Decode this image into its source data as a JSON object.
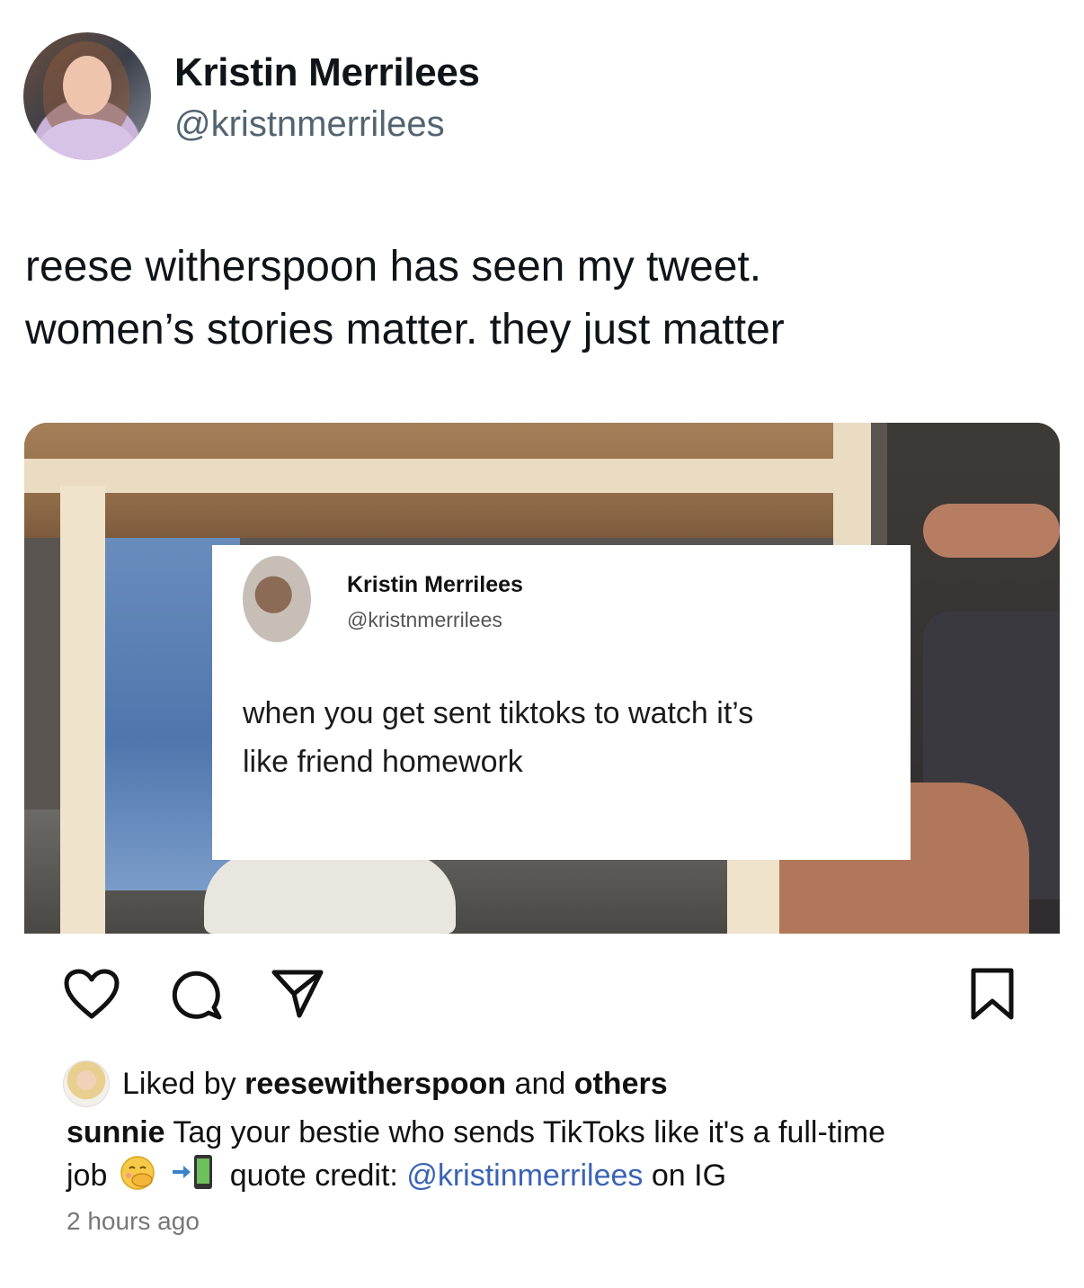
{
  "tweet": {
    "display_name": "Kristin Merrilees",
    "handle": "@kristnmerrilees",
    "text_lines": [
      "reese witherspoon has seen my tweet.",
      "women’s stories matter. they just matter"
    ]
  },
  "embedded_post": {
    "quote_card": {
      "display_name": "Kristin Merrilees",
      "handle": "@kristnmerrilees",
      "text_lines": [
        "when you get sent tiktoks to watch it’s",
        "like friend homework"
      ]
    },
    "actions": {
      "like_icon": "heart-icon",
      "comment_icon": "comment-icon",
      "share_icon": "send-icon",
      "save_icon": "bookmark-icon"
    },
    "likes": {
      "prefix": "Liked by",
      "user": "reesewitherspoon",
      "middle": "and",
      "others": "others"
    },
    "caption": {
      "author": "sunnie",
      "text1": "Tag your bestie who sends TikToks like it's a full-time",
      "text2_start": "job",
      "text2_mid": "quote credit:",
      "mention": "@kristinmerrilees",
      "text2_end": "on IG",
      "emoji_1": "face-with-hand-over-mouth",
      "emoji_2": "arrow-into-phone",
      "mention_color": "#3a63b5"
    },
    "timestamp": "2 hours ago"
  }
}
